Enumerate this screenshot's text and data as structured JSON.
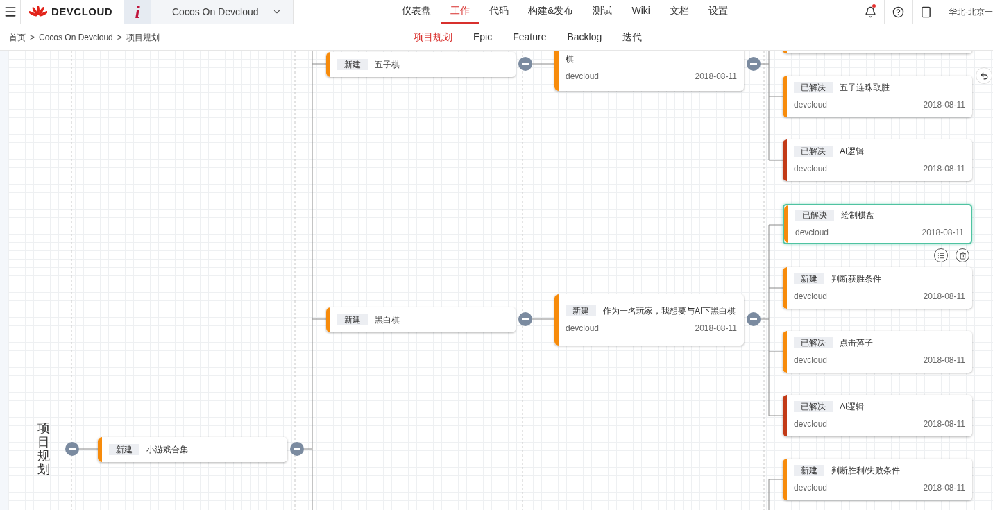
{
  "header": {
    "brand": "DEVCLOUD",
    "project_icon": "i",
    "project": "Cocos On Devcloud",
    "nav": [
      {
        "label": "仪表盘",
        "selected": false
      },
      {
        "label": "工作",
        "selected": true
      },
      {
        "label": "代码",
        "selected": false
      },
      {
        "label": "构建&发布",
        "selected": false
      },
      {
        "label": "测试",
        "selected": false
      },
      {
        "label": "Wiki",
        "selected": false
      },
      {
        "label": "文档",
        "selected": false
      },
      {
        "label": "设置",
        "selected": false
      }
    ],
    "has_unread": true,
    "region": "华北-北京一"
  },
  "breadcrumb": {
    "separator": ">",
    "items": [
      "首页",
      "Cocos On Devcloud",
      "项目规划"
    ]
  },
  "subtabs": [
    {
      "label": "项目规划",
      "selected": true
    },
    {
      "label": "Epic",
      "selected": false
    },
    {
      "label": "Feature",
      "selected": false
    },
    {
      "label": "Backlog",
      "selected": false
    },
    {
      "label": "迭代",
      "selected": false
    }
  ],
  "tree": {
    "label": "项目规划",
    "expanded": true,
    "children": [
      {
        "status": "新建",
        "title": "小游戏合集",
        "color": "#f78b0b",
        "expanded": true,
        "children": [
          {
            "status": "新建",
            "title": "五子棋",
            "color": "#f78b0b",
            "expanded": true,
            "children": [
              {
                "title": "棋",
                "owner": "devcloud",
                "date": "2018-08-11",
                "color": "#f78b0b",
                "expanded": true,
                "children": [
                  {
                    "status": "已解决",
                    "title": "五子连珠取胜",
                    "owner": "devcloud",
                    "date": "2018-08-11",
                    "color": "#f78b0b",
                    "selected": false
                  },
                  {
                    "status": "已解决",
                    "title": "AI逻辑",
                    "owner": "devcloud",
                    "date": "2018-08-11",
                    "color": "#c23a17",
                    "selected": false
                  }
                ]
              }
            ]
          },
          {
            "status": "新建",
            "title": "黑白棋",
            "color": "#f78b0b",
            "expanded": true,
            "children": [
              {
                "status": "新建",
                "title": "作为一名玩家，我想要与AI下黑白棋",
                "owner": "devcloud",
                "date": "2018-08-11",
                "color": "#f78b0b",
                "expanded": true,
                "children": [
                  {
                    "status": "已解决",
                    "title": "绘制棋盘",
                    "owner": "devcloud",
                    "date": "2018-08-11",
                    "color": "#f78b0b",
                    "selected": true
                  },
                  {
                    "status": "新建",
                    "title": "判断获胜条件",
                    "owner": "devcloud",
                    "date": "2018-08-11",
                    "color": "#f78b0b",
                    "selected": false
                  },
                  {
                    "status": "已解决",
                    "title": "点击落子",
                    "owner": "devcloud",
                    "date": "2018-08-11",
                    "color": "#f78b0b",
                    "selected": false
                  },
                  {
                    "status": "已解决",
                    "title": "AI逻辑",
                    "owner": "devcloud",
                    "date": "2018-08-11",
                    "color": "#c23a17",
                    "selected": false
                  }
                ]
              }
            ]
          }
        ]
      }
    ]
  },
  "partial_tasks": [
    {
      "status": "新建",
      "title": "判断胜利/失败条件",
      "owner": "devcloud",
      "date": "2018-08-11",
      "color": "#f78b0b",
      "selected": false
    }
  ]
}
